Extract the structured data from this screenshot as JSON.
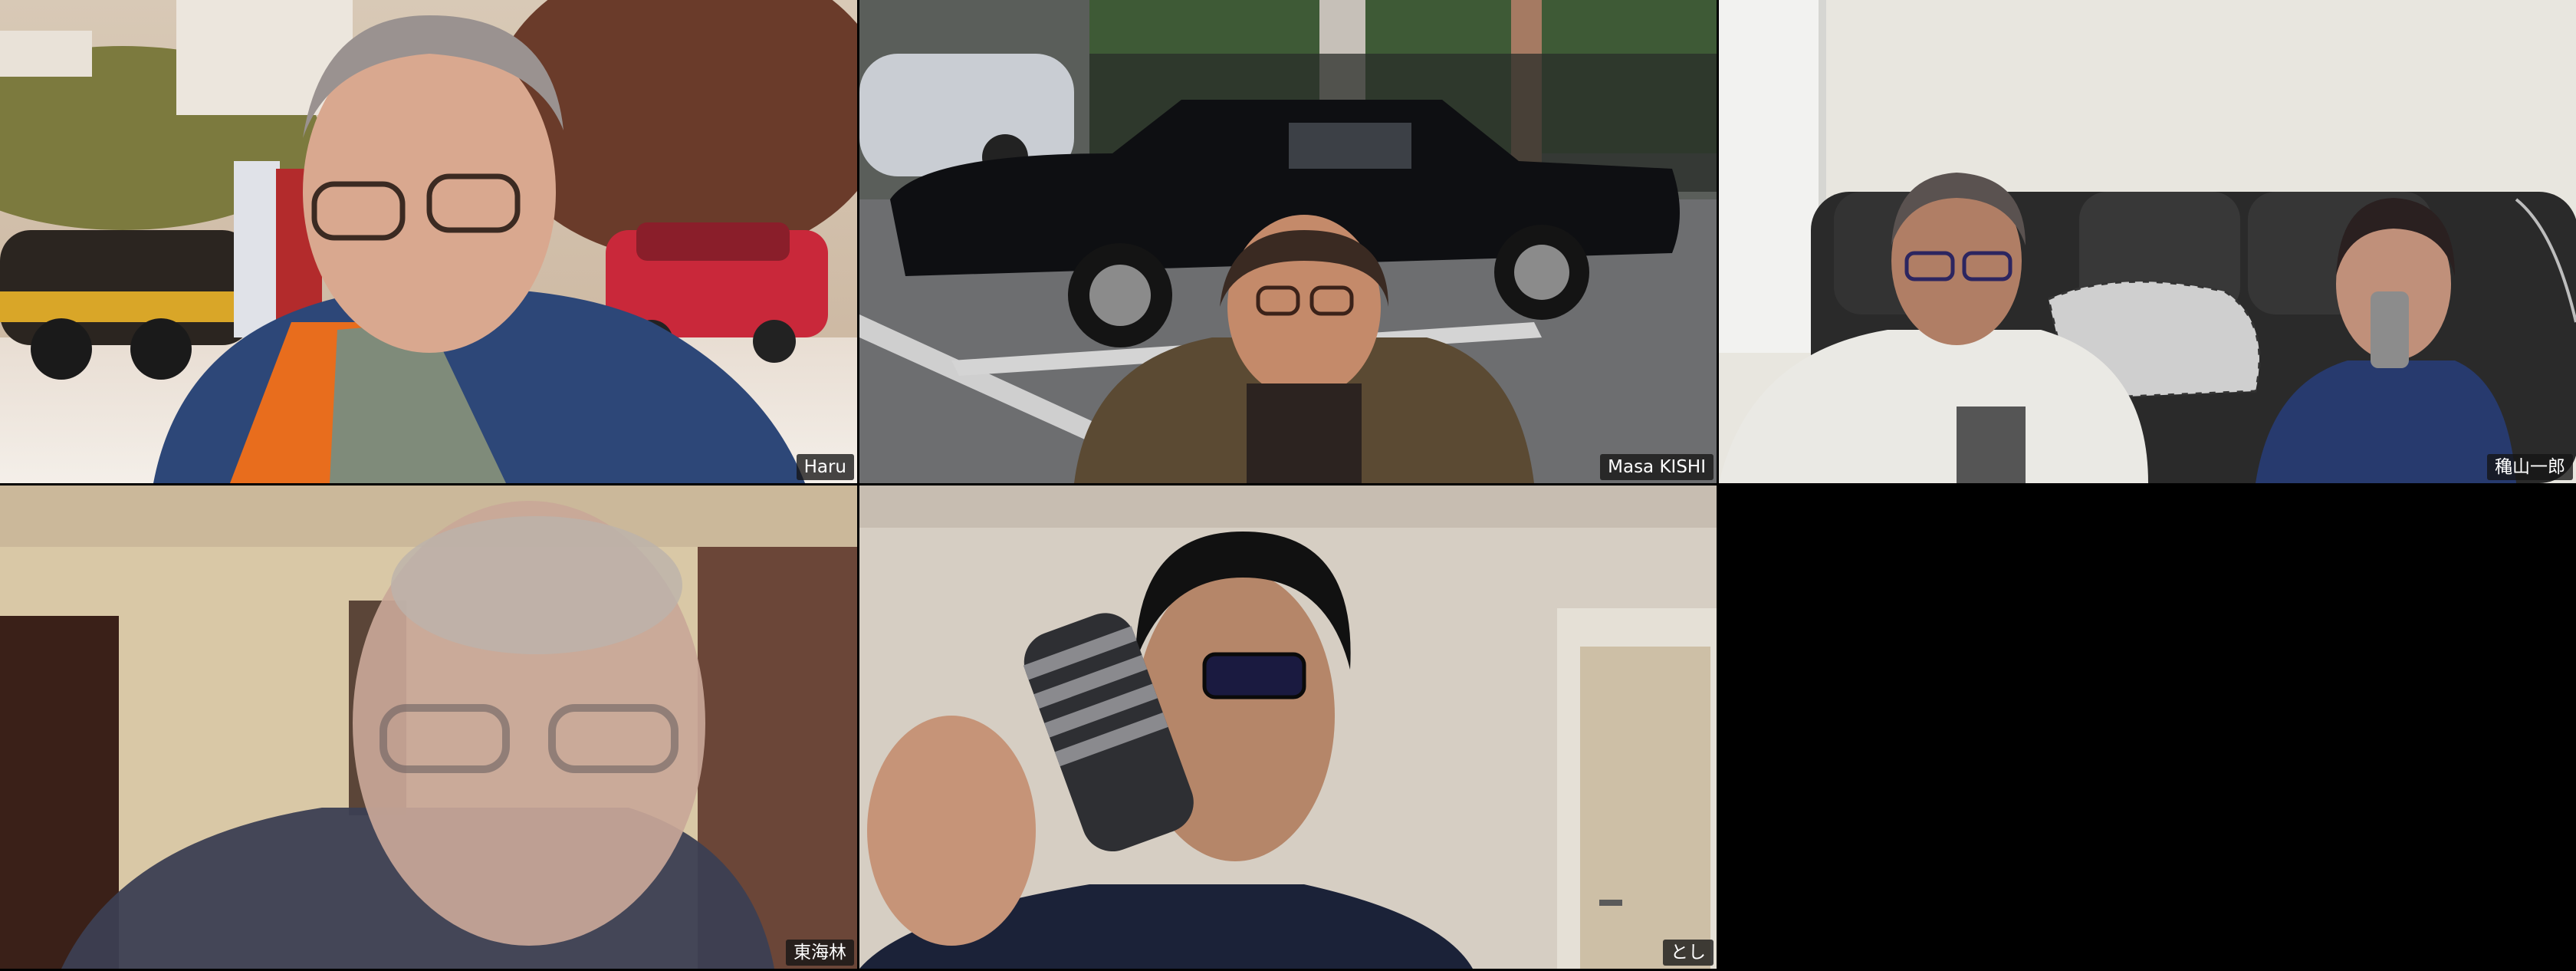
{
  "app": {
    "view": "gallery"
  },
  "participants": [
    {
      "name": "Haru"
    },
    {
      "name": "Masa KISHI"
    },
    {
      "name": "穐山一郎"
    },
    {
      "name": "東海林"
    },
    {
      "name": "とし"
    }
  ],
  "colors": {
    "background": "#000000",
    "label_bg": "#141414",
    "label_text": "#ffffff"
  }
}
